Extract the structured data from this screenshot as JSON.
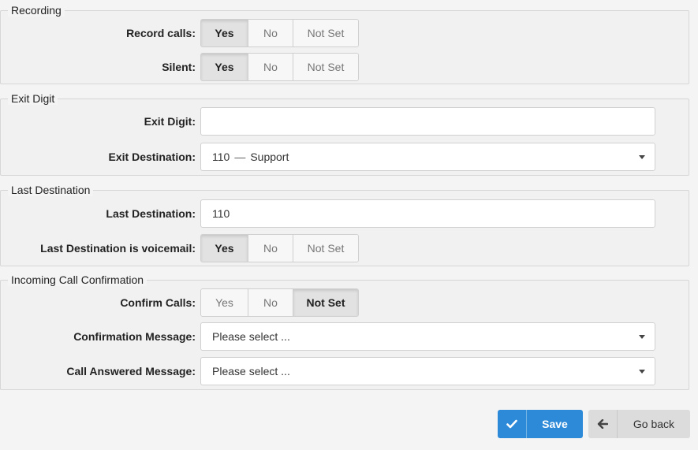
{
  "recording": {
    "legend": "Recording",
    "record_calls": {
      "label": "Record calls:",
      "options": [
        "Yes",
        "No",
        "Not Set"
      ],
      "selected": "Yes"
    },
    "silent": {
      "label": "Silent:",
      "options": [
        "Yes",
        "No",
        "Not Set"
      ],
      "selected": "Yes"
    }
  },
  "exit_digit": {
    "legend": "Exit Digit",
    "digit": {
      "label": "Exit Digit:",
      "value": ""
    },
    "destination": {
      "label": "Exit Destination:",
      "number": "110",
      "separator": "—",
      "name": "Support"
    }
  },
  "last_destination": {
    "legend": "Last Destination",
    "destination": {
      "label": "Last Destination:",
      "value": "110"
    },
    "voicemail": {
      "label": "Last Destination is voicemail:",
      "options": [
        "Yes",
        "No",
        "Not Set"
      ],
      "selected": "Yes"
    }
  },
  "incoming_confirmation": {
    "legend": "Incoming Call Confirmation",
    "confirm_calls": {
      "label": "Confirm Calls:",
      "options": [
        "Yes",
        "No",
        "Not Set"
      ],
      "selected": "Not Set"
    },
    "confirmation_message": {
      "label": "Confirmation Message:",
      "value": "Please select ..."
    },
    "answered_message": {
      "label": "Call Answered Message:",
      "value": "Please select ..."
    }
  },
  "actions": {
    "save_label": "Save",
    "back_label": "Go back"
  },
  "colors": {
    "primary": "#2d8ad8",
    "secondary": "#dcdcdc"
  },
  "icons": {
    "save": "check-icon",
    "back": "arrow-left-icon",
    "dropdown": "caret-down-icon"
  }
}
